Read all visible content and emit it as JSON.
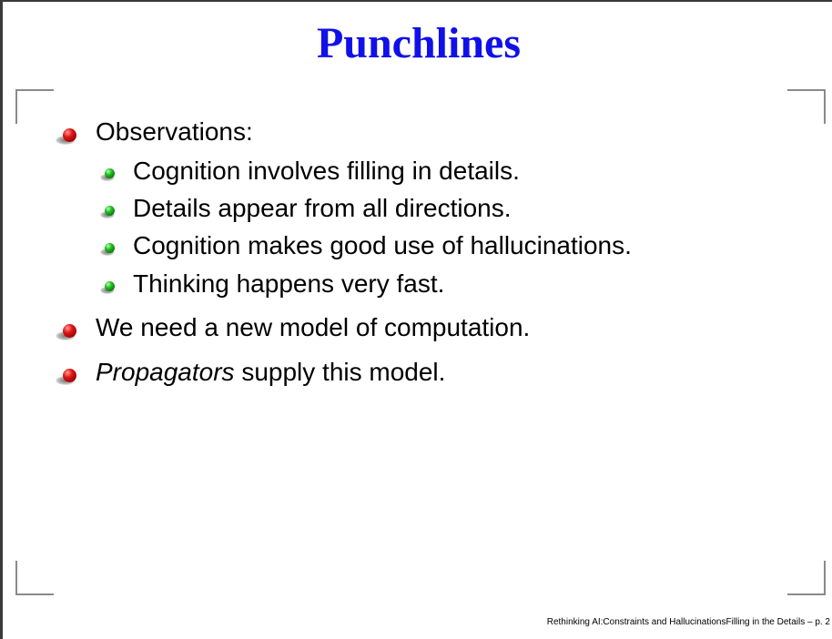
{
  "slide": {
    "title": "Punchlines",
    "items": [
      {
        "text": "Observations:",
        "subitems": [
          "Cognition involves filling in details.",
          "Details appear from all directions.",
          "Cognition makes good use of hallucinations.",
          "Thinking happens very fast."
        ]
      },
      {
        "text": "We need a new model of computation."
      },
      {
        "emphasis": "Propagators",
        "text": " supply this model."
      }
    ],
    "footer": "Rethinking AI:Constraints and HallucinationsFilling in the Details – p. 2"
  },
  "colors": {
    "title": "#1010e8",
    "bullet_level1": "#e01818",
    "bullet_level2": "#22c022",
    "corner_marks": "#8a8a8a"
  },
  "icons": {
    "level1_bullet": "red-ball-bullet-icon",
    "level2_bullet": "green-ball-bullet-icon"
  }
}
